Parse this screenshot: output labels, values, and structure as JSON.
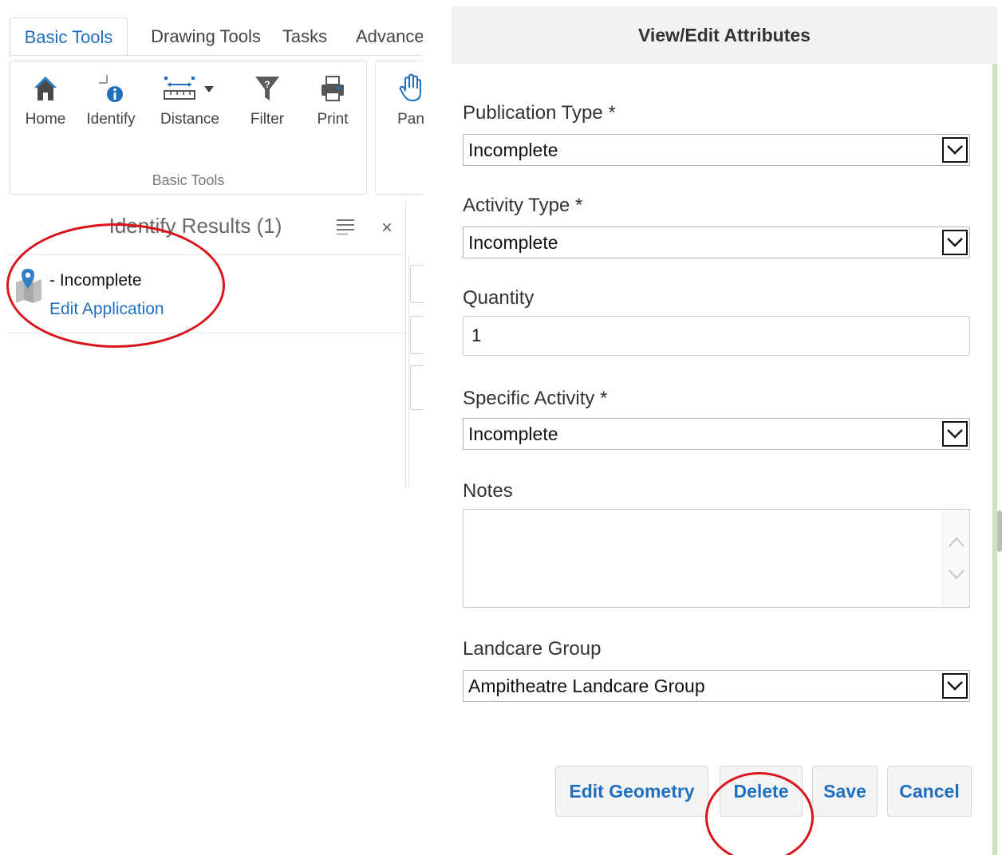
{
  "ribbon": {
    "tabs": [
      {
        "label": "Basic Tools",
        "active": true
      },
      {
        "label": "Drawing Tools",
        "active": false
      },
      {
        "label": "Tasks",
        "active": false
      },
      {
        "label": "Advance",
        "active": false
      }
    ],
    "tools": [
      {
        "label": "Home",
        "icon": "home-icon"
      },
      {
        "label": "Identify",
        "icon": "identify-icon"
      },
      {
        "label": "Distance",
        "icon": "ruler-icon"
      },
      {
        "label": "Filter",
        "icon": "filter-icon"
      },
      {
        "label": "Print",
        "icon": "printer-icon"
      },
      {
        "label": "Pan",
        "icon": "hand-icon"
      }
    ],
    "group_label": "Basic Tools"
  },
  "identify_results": {
    "title": "Identify Results (1)",
    "close": "×",
    "items": [
      {
        "title": "- Incomplete",
        "link": "Edit Application"
      }
    ]
  },
  "attributes": {
    "title": "View/Edit Attributes",
    "fields": {
      "publication_type": {
        "label": "Publication Type *",
        "value": "Incomplete"
      },
      "activity_type": {
        "label": "Activity Type *",
        "value": "Incomplete"
      },
      "quantity": {
        "label": "Quantity",
        "value": "1"
      },
      "specific_activity": {
        "label": "Specific Activity *",
        "value": "Incomplete"
      },
      "notes": {
        "label": "Notes",
        "value": ""
      },
      "landcare_group": {
        "label": "Landcare Group",
        "value": "Ampitheatre Landcare Group"
      }
    },
    "buttons": {
      "edit_geometry": "Edit Geometry",
      "delete": "Delete",
      "save": "Save",
      "cancel": "Cancel"
    }
  },
  "colors": {
    "accent_blue": "#1f6fc0",
    "annotation_red": "#d9151c",
    "header_gray": "#f2f2f2"
  }
}
